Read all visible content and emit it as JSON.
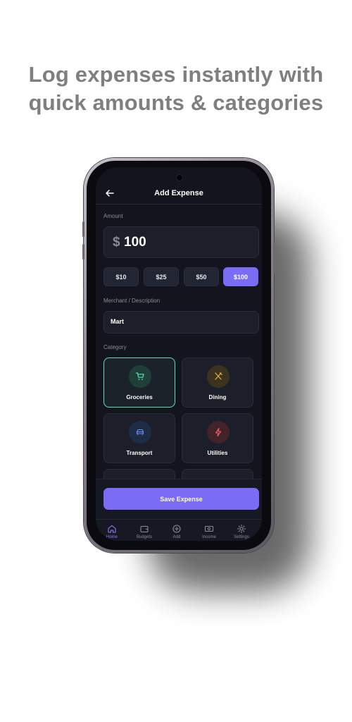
{
  "headline": "Log expenses instantly with quick amounts & categories",
  "status": {
    "time": "",
    "icons": ""
  },
  "header": {
    "title": "Add Expense"
  },
  "amount": {
    "label": "Amount",
    "currency": "$",
    "value": "100"
  },
  "quick_amounts": [
    {
      "label": "$10",
      "active": false
    },
    {
      "label": "$25",
      "active": false
    },
    {
      "label": "$50",
      "active": false
    },
    {
      "label": "$100",
      "active": true
    }
  ],
  "merchant": {
    "label": "Merchant / Description",
    "value": "Mart"
  },
  "category": {
    "label": "Category",
    "items": [
      {
        "label": "Groceries",
        "icon": "cart-icon",
        "selected": true
      },
      {
        "label": "Dining",
        "icon": "utensils-icon",
        "selected": false
      },
      {
        "label": "Transport",
        "icon": "car-icon",
        "selected": false
      },
      {
        "label": "Utilities",
        "icon": "bolt-icon",
        "selected": false
      }
    ]
  },
  "save_button": "Save Expense",
  "tabs": [
    {
      "label": "Home",
      "icon": "home-icon",
      "active": true
    },
    {
      "label": "Budgets",
      "icon": "wallet-icon",
      "active": false
    },
    {
      "label": "Add",
      "icon": "plus-circle-icon",
      "active": false
    },
    {
      "label": "Income",
      "icon": "cash-icon",
      "active": false
    },
    {
      "label": "Settings",
      "icon": "gear-icon",
      "active": false
    }
  ],
  "colors": {
    "accent": "#7a6cf5",
    "selected_border": "#5ee0b0",
    "background": "#13141d",
    "headline": "#7f7f7f"
  }
}
